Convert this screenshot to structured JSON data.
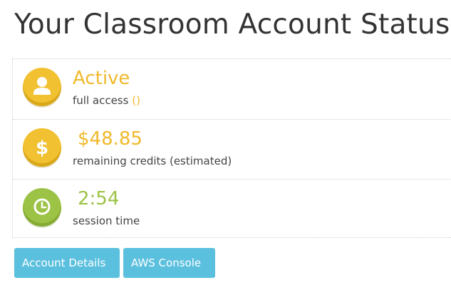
{
  "page": {
    "title": "Your Classroom Account Status"
  },
  "status": {
    "access": {
      "value": "Active",
      "caption": "full access",
      "caption_paren": "()",
      "icon": "user-icon",
      "color": "#f0b92b"
    },
    "credits": {
      "value": "$48.85",
      "caption": "remaining credits (estimated)",
      "icon": "dollar-icon",
      "color": "#f0b92b"
    },
    "session": {
      "value": "2:54",
      "caption": "session time",
      "icon": "clock-icon",
      "color": "#9cc346"
    }
  },
  "actions": {
    "account_details_label": "Account Details",
    "aws_console_label": "AWS Console",
    "button_color": "#5bc0de"
  }
}
